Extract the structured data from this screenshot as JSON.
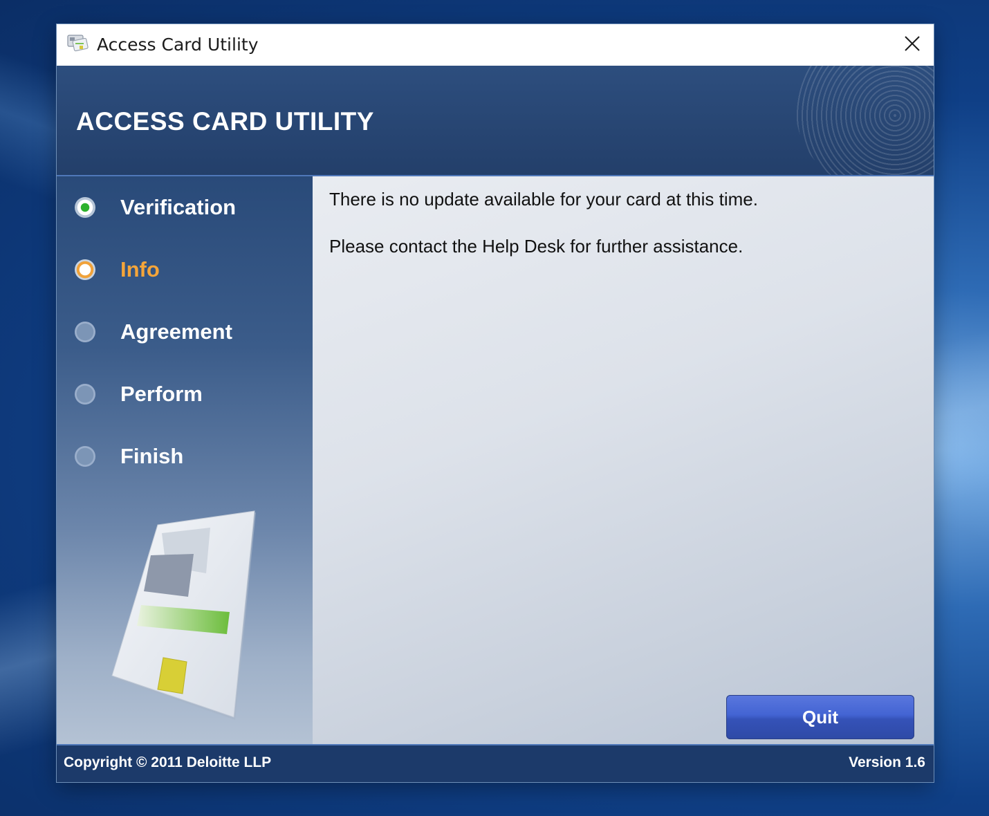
{
  "window": {
    "title": "Access Card Utility",
    "icon": "access-card-app-icon",
    "close_icon": "close-icon"
  },
  "header": {
    "heading": "ACCESS CARD UTILITY"
  },
  "steps": [
    {
      "label": "Verification",
      "state": "done"
    },
    {
      "label": "Info",
      "state": "current"
    },
    {
      "label": "Agreement",
      "state": "pending"
    },
    {
      "label": "Perform",
      "state": "pending"
    },
    {
      "label": "Finish",
      "state": "pending"
    }
  ],
  "content": {
    "message_1": "There is no update available for your card at this time.",
    "message_2": "Please contact the Help Desk for further assistance."
  },
  "buttons": {
    "quit_label": "Quit"
  },
  "footer": {
    "copyright": "Copyright © 2011 Deloitte LLP",
    "version": "Version 1.6"
  },
  "colors": {
    "header_bg": "#274572",
    "current_step": "#f5a53a",
    "done_step": "#2db22d",
    "quit_button": "#4364d3",
    "footer_bg": "#1c3a6a"
  }
}
